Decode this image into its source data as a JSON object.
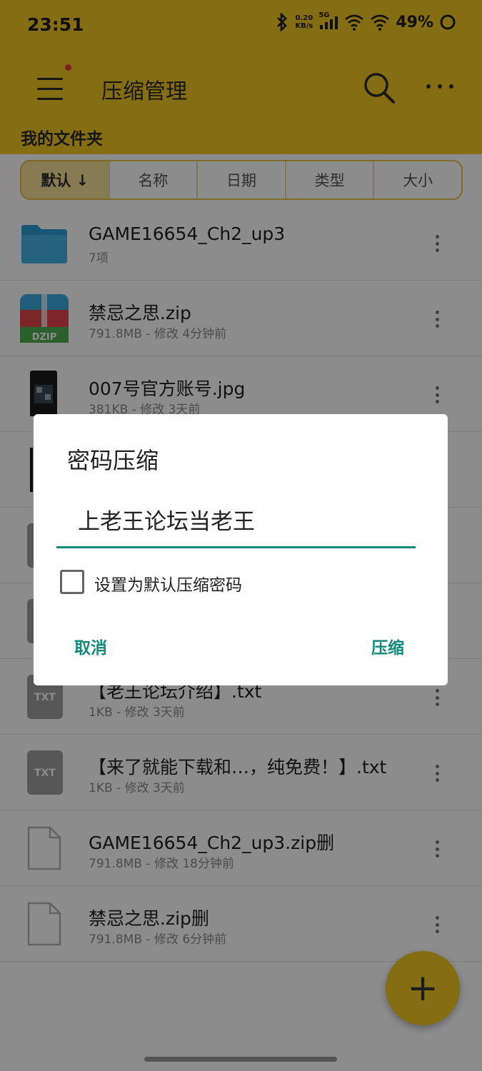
{
  "status_bar": {
    "time": "23:51",
    "net_speed_value": "0.20",
    "net_speed_unit": "KB/s",
    "network_type": "5G",
    "battery": "49%"
  },
  "app_bar": {
    "title": "压缩管理",
    "section_title": "我的文件夹"
  },
  "sort_tabs": [
    {
      "label": "默认 ↓",
      "active": true
    },
    {
      "label": "名称",
      "active": false
    },
    {
      "label": "日期",
      "active": false
    },
    {
      "label": "类型",
      "active": false
    },
    {
      "label": "大小",
      "active": false
    }
  ],
  "files": [
    {
      "name": "GAME16654_Ch2_up3",
      "meta": "7项",
      "icon": "folder-icon"
    },
    {
      "name": "禁忌之思.zip",
      "meta": "791.8MB - 修改 4分钟前",
      "icon": "zip-archive-icon",
      "icon_label": "DZIP"
    },
    {
      "name": "007号官方账号.jpg",
      "meta": "381KB - 修改 3天前",
      "icon": "image-thumbnail-icon"
    },
    {
      "name": "",
      "meta": "",
      "icon": "image-thumbnail-icon"
    },
    {
      "name": "",
      "meta": "",
      "icon": "txt-file-icon"
    },
    {
      "name": "",
      "meta": "",
      "icon": "txt-file-icon"
    },
    {
      "name": "【老王论坛介绍】.txt",
      "meta": "1KB - 修改 3天前",
      "icon": "txt-file-icon",
      "icon_label": "TXT"
    },
    {
      "name": "【来了就能下载和…，纯免费！】.txt",
      "meta": "1KB - 修改 3天前",
      "icon": "txt-file-icon",
      "icon_label": "TXT"
    },
    {
      "name": "GAME16654_Ch2_up3.zip删",
      "meta": "791.8MB - 修改 18分钟前",
      "icon": "blank-file-icon"
    },
    {
      "name": "禁忌之思.zip删",
      "meta": "791.8MB - 修改 6分钟前",
      "icon": "blank-file-icon"
    }
  ],
  "dialog": {
    "title": "密码压缩",
    "password_value": "上老王论坛当老王",
    "checkbox_label": "设置为默认压缩密码",
    "checkbox_checked": false,
    "cancel_label": "取消",
    "confirm_label": "压缩"
  },
  "fab": {
    "label": "+"
  },
  "colors": {
    "accent": "#f2c724",
    "dialog_accent": "#13897a"
  }
}
